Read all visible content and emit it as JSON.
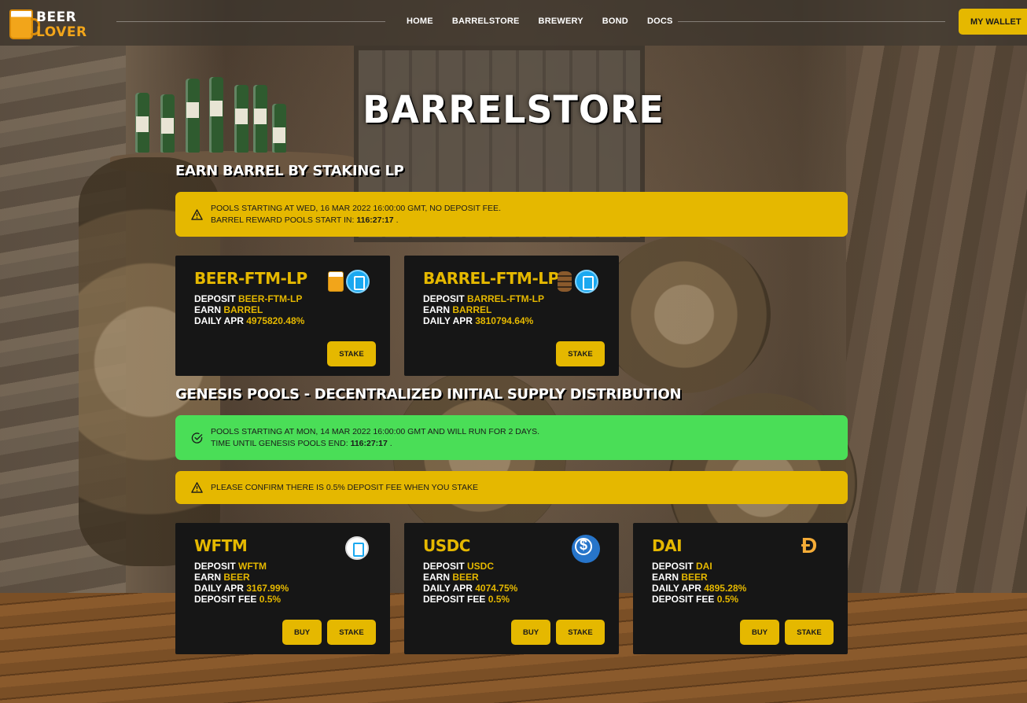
{
  "header": {
    "logo_line1": "BEER",
    "logo_line2": "LOVER",
    "nav": [
      "HOME",
      "BARRELSTORE",
      "BREWERY",
      "BOND",
      "DOCS"
    ],
    "wallet_label": "MY WALLET"
  },
  "page_title": "BARRELSTORE",
  "lp_section": {
    "title": "EARN BARREL BY STAKING LP",
    "alert_line1": "POOLS STARTING AT WED, 16 MAR 2022 16:00:00 GMT, NO DEPOSIT FEE.",
    "alert_line2_prefix": "BARREL REWARD POOLS START IN: ",
    "alert_line2_time": "116:27:17",
    "alert_line2_suffix": " .",
    "cards": [
      {
        "title": "BEER-FTM-LP",
        "deposit_label": "DEPOSIT ",
        "deposit": "BEER-FTM-LP",
        "earn_label": "EARN ",
        "earn": "BARREL",
        "apr_label": "DAILY APR ",
        "apr": "4975820.48%",
        "stake_label": "STAKE",
        "icons": [
          "beer-mug-icon",
          "fantom-icon"
        ]
      },
      {
        "title": "BARREL-FTM-LP",
        "deposit_label": "DEPOSIT ",
        "deposit": "BARREL-FTM-LP",
        "earn_label": "EARN ",
        "earn": "BARREL",
        "apr_label": "DAILY APR ",
        "apr": "3810794.64%",
        "stake_label": "STAKE",
        "icons": [
          "barrel-icon",
          "fantom-icon"
        ]
      }
    ]
  },
  "genesis_section": {
    "title": "GENESIS POOLS - DECENTRALIZED INITIAL SUPPLY DISTRIBUTION",
    "alert_green_line1": "POOLS STARTING AT MON, 14 MAR 2022 16:00:00 GMT AND WILL RUN FOR 2 DAYS.",
    "alert_green_line2_prefix": "TIME UNTIL GENESIS POOLS END: ",
    "alert_green_line2_time": "116:27:17",
    "alert_green_line2_suffix": " .",
    "alert_fee": "PLEASE CONFIRM THERE IS 0.5% DEPOSIT FEE WHEN YOU STAKE",
    "cards": [
      {
        "title": "WFTM",
        "deposit_label": "DEPOSIT ",
        "deposit": "WFTM",
        "earn_label": "EARN ",
        "earn": "BEER",
        "apr_label": "DAILY APR ",
        "apr": "3167.99%",
        "fee_label": "DEPOSIT FEE ",
        "fee": "0.5%",
        "buy_label": "BUY",
        "stake_label": "STAKE",
        "icon": "wftm-icon"
      },
      {
        "title": "USDC",
        "deposit_label": "DEPOSIT ",
        "deposit": "USDC",
        "earn_label": "EARN ",
        "earn": "BEER",
        "apr_label": "DAILY APR ",
        "apr": "4074.75%",
        "fee_label": "DEPOSIT FEE ",
        "fee": "0.5%",
        "buy_label": "BUY",
        "stake_label": "STAKE",
        "icon": "usdc-icon"
      },
      {
        "title": "DAI",
        "deposit_label": "DEPOSIT ",
        "deposit": "DAI",
        "earn_label": "EARN ",
        "earn": "BEER",
        "apr_label": "DAILY APR ",
        "apr": "4895.28%",
        "fee_label": "DEPOSIT FEE ",
        "fee": "0.5%",
        "buy_label": "BUY",
        "stake_label": "STAKE",
        "icon": "dai-icon",
        "icon_glyph": "Đ"
      }
    ]
  },
  "colors": {
    "accent": "#e5b800",
    "success": "#4ade57",
    "card_bg": "#161616"
  }
}
